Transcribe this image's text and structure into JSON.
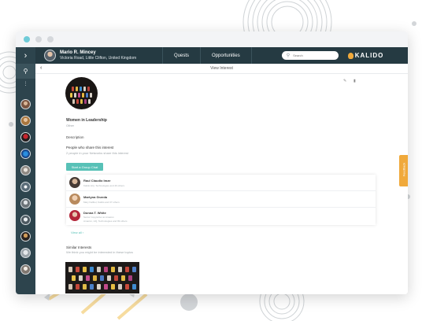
{
  "window": {
    "traffic_lights": [
      "close-dot",
      "minimize-dot",
      "maximize-dot"
    ]
  },
  "topbar": {
    "menu_icon": "chevron-right",
    "user_name": "Mario R. Mincey",
    "user_location": "Victoria Road, Little Clifton, United Kingdom",
    "nav": [
      "Quests",
      "Opportunities"
    ],
    "search_placeholder": "Search",
    "search_icon": "search",
    "logo_text": "KALIDO",
    "logo_icon": "lightbulb"
  },
  "sidebar": {
    "search_icon": "search",
    "more_icon": "more-vertical"
  },
  "subbar": {
    "back_icon": "chevron-left",
    "title": "View Interest"
  },
  "interest": {
    "edit_icon": "pencil",
    "delete_icon": "trash",
    "title": "Women in Leadership",
    "category": "Other",
    "description_label": "Description",
    "share_title": "People who share this interest",
    "share_subtitle": "2 people in your Networks share this interest",
    "group_chat_button": "Start a Group Chat",
    "people": [
      {
        "name": "Raul Claudio Imze",
        "sub": "Kalido HQ, Technologies and 40 others"
      },
      {
        "name": "Martyna Grzeda",
        "sub": "Mary Kalibel, Kalido and 37 others"
      },
      {
        "name": "Donna T. White",
        "sub": "Senior Copywriter at Amazon",
        "sub2": "Amazon, HQ, Technologies and 99 others"
      }
    ],
    "view_all": "View all",
    "view_all_icon": "chevron-right",
    "similar_title": "Similar Interests",
    "similar_subtitle": "We think you might be interested in these topics"
  },
  "feedback_label": "Feedback",
  "colors": {
    "topbar": "#253a42",
    "sidebar": "#2d444d",
    "accent": "#58c1b7",
    "feedback": "#f0a93b"
  }
}
